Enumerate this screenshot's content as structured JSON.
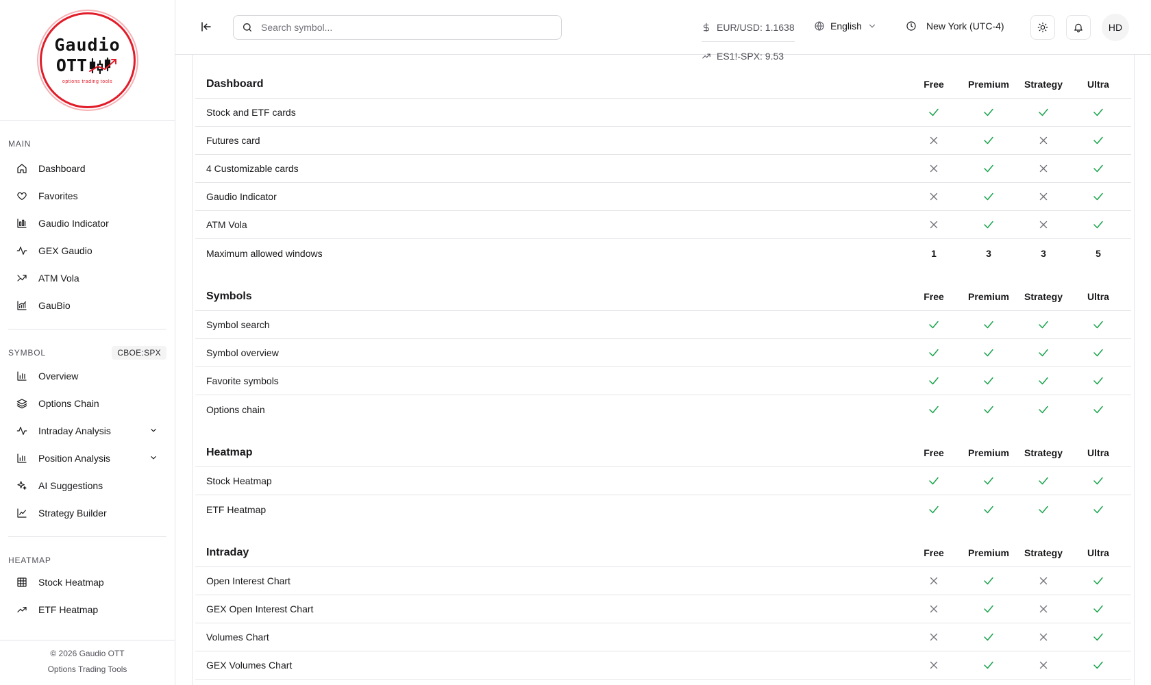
{
  "brand": {
    "logo_line1": "Gaudio",
    "logo_line2": "OTT",
    "logo_sub": "options trading tools",
    "accent": "#e11d2a"
  },
  "sidebar": {
    "main_label": "MAIN",
    "main_items": [
      {
        "label": "Dashboard",
        "icon": "home-icon"
      },
      {
        "label": "Favorites",
        "icon": "heart-icon"
      },
      {
        "label": "Gaudio Indicator",
        "icon": "chart-bar-icon"
      },
      {
        "label": "GEX Gaudio",
        "icon": "activity-icon"
      },
      {
        "label": "ATM Vola",
        "icon": "trend-icon"
      },
      {
        "label": "GauBio",
        "icon": "chart-line-icon"
      }
    ],
    "symbol_label": "SYMBOL",
    "symbol_badge": "CBOE:SPX",
    "symbol_items": [
      {
        "label": "Overview",
        "icon": "bar-chart-icon"
      },
      {
        "label": "Options Chain",
        "icon": "layers-icon"
      },
      {
        "label": "Intraday Analysis",
        "icon": "activity-icon",
        "expandable": true
      },
      {
        "label": "Position Analysis",
        "icon": "bar-chart-icon",
        "expandable": true
      },
      {
        "label": "AI Suggestions",
        "icon": "sparkles-icon"
      },
      {
        "label": "Strategy Builder",
        "icon": "line-chart-icon"
      }
    ],
    "heatmap_label": "HEATMAP",
    "heatmap_items": [
      {
        "label": "Stock Heatmap",
        "icon": "grid-icon"
      },
      {
        "label": "ETF Heatmap",
        "icon": "trending-up-icon"
      }
    ],
    "footer_line1": "© 2026 Gaudio OTT",
    "footer_line2": "Options Trading Tools"
  },
  "header": {
    "search_placeholder": "Search symbol...",
    "ticker_1": "EUR/USD: 1.1638",
    "ticker_2": "ES1!-SPX: 9.53",
    "language": "English",
    "timezone": "New York (UTC-4)",
    "avatar": "HD"
  },
  "plans": [
    "Free",
    "Premium",
    "Strategy",
    "Ultra"
  ],
  "sections": [
    {
      "title": "Dashboard",
      "rows": [
        {
          "feature": "Stock and ETF cards",
          "values": [
            "yes",
            "yes",
            "yes",
            "yes"
          ]
        },
        {
          "feature": "Futures card",
          "values": [
            "no",
            "yes",
            "no",
            "yes"
          ]
        },
        {
          "feature": "4 Customizable cards",
          "values": [
            "no",
            "yes",
            "no",
            "yes"
          ]
        },
        {
          "feature": "Gaudio Indicator",
          "values": [
            "no",
            "yes",
            "no",
            "yes"
          ]
        },
        {
          "feature": "ATM Vola",
          "values": [
            "no",
            "yes",
            "no",
            "yes"
          ]
        },
        {
          "feature": "Maximum allowed windows",
          "values": [
            "1",
            "3",
            "3",
            "5"
          ]
        }
      ]
    },
    {
      "title": "Symbols",
      "rows": [
        {
          "feature": "Symbol search",
          "values": [
            "yes",
            "yes",
            "yes",
            "yes"
          ]
        },
        {
          "feature": "Symbol overview",
          "values": [
            "yes",
            "yes",
            "yes",
            "yes"
          ]
        },
        {
          "feature": "Favorite symbols",
          "values": [
            "yes",
            "yes",
            "yes",
            "yes"
          ]
        },
        {
          "feature": "Options chain",
          "values": [
            "yes",
            "yes",
            "yes",
            "yes"
          ]
        }
      ]
    },
    {
      "title": "Heatmap",
      "rows": [
        {
          "feature": "Stock Heatmap",
          "values": [
            "yes",
            "yes",
            "yes",
            "yes"
          ]
        },
        {
          "feature": "ETF Heatmap",
          "values": [
            "yes",
            "yes",
            "yes",
            "yes"
          ]
        }
      ]
    },
    {
      "title": "Intraday",
      "rows": [
        {
          "feature": "Open Interest Chart",
          "values": [
            "no",
            "yes",
            "no",
            "yes"
          ]
        },
        {
          "feature": "GEX Open Interest Chart",
          "values": [
            "no",
            "yes",
            "no",
            "yes"
          ]
        },
        {
          "feature": "Volumes Chart",
          "values": [
            "no",
            "yes",
            "no",
            "yes"
          ]
        },
        {
          "feature": "GEX Volumes Chart",
          "values": [
            "no",
            "yes",
            "no",
            "yes"
          ]
        }
      ]
    }
  ]
}
